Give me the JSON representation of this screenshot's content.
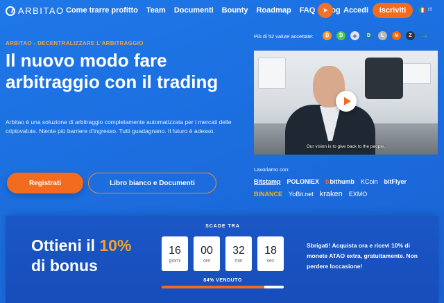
{
  "brand": {
    "name": "ARBITAO"
  },
  "nav": {
    "links": [
      "Come trarre profitto",
      "Team",
      "Documenti",
      "Bounty",
      "Roadmap",
      "FAQ",
      "Blog"
    ],
    "login": "Accedi",
    "signup": "Iscriviti",
    "lang": "IT"
  },
  "hero": {
    "kicker": "ARBITAO - DECENTRALIZZARE L'ARBITRAGGIO",
    "headline": "Il nuovo modo fare arbitraggio con il trading",
    "description": "Arbitao è una soluzione di arbitraggio completamente automatizzata per i mercati delle criptovalute. Niente più barriere d'ingresso. Tutti guadagnano. Il futuro è adesso.",
    "register_button": "Registrati",
    "whitepaper_button": "Libro bianco e Documenti"
  },
  "currencies": {
    "label": "Più di 52 valute accettate:",
    "coins": [
      {
        "icon": "bitcoin-icon",
        "glyph": "₿",
        "color": "#f7931a"
      },
      {
        "icon": "bitcoin-cash-icon",
        "glyph": "₿",
        "color": "#4cc947"
      },
      {
        "icon": "ethereum-icon",
        "glyph": "◆",
        "color": "#6b7bb8"
      },
      {
        "icon": "dash-icon",
        "glyph": "D",
        "color": "#1c75bc"
      },
      {
        "icon": "litecoin-icon",
        "glyph": "Ł",
        "color": "#b8b8b8"
      },
      {
        "icon": "monero-icon",
        "glyph": "M",
        "color": "#ff6600"
      },
      {
        "icon": "zcash-icon",
        "glyph": "Z",
        "color": "#2f3640"
      }
    ]
  },
  "video": {
    "caption": "Our vision is to give back to the people."
  },
  "partners": {
    "label": "Lavoriamo con:",
    "names": [
      "Bitstamp",
      "POLONIEX",
      "bithumb",
      "KCoin",
      "bitFlyer",
      "BINANCE",
      "YoBit.net",
      "kraken",
      "EXMO"
    ]
  },
  "bonus": {
    "title_prefix": "Ottieni il",
    "percent": "10%",
    "title_suffix": "di bonus",
    "expires_label": "SCADE TRA",
    "countdown": [
      {
        "value": "16",
        "unit": "giorni"
      },
      {
        "value": "00",
        "unit": "ore"
      },
      {
        "value": "32",
        "unit": "min"
      },
      {
        "value": "18",
        "unit": "sec"
      }
    ],
    "sold_label": "84% VENDUTO",
    "sold_fraction": 0.84,
    "hurry_text": "Sbrigati! Acquista ora e ricevi 10% di monete ATAO extra, gratuitamente. Non perdere loccasione!"
  },
  "colors": {
    "accent": "#f26b1f",
    "highlight": "#f7a12c",
    "background": "#1f78e8"
  }
}
